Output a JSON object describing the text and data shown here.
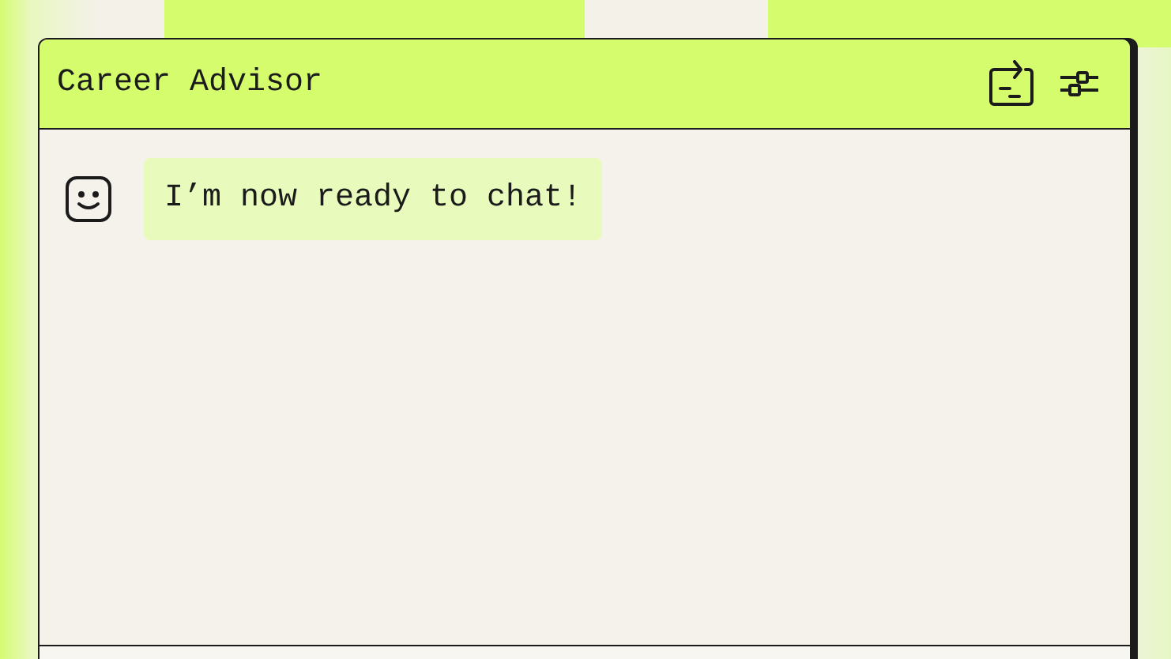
{
  "window": {
    "title": "Career Advisor"
  },
  "messages": [
    {
      "kind": "bot",
      "text": "I’m now ready to chat!"
    }
  ]
}
